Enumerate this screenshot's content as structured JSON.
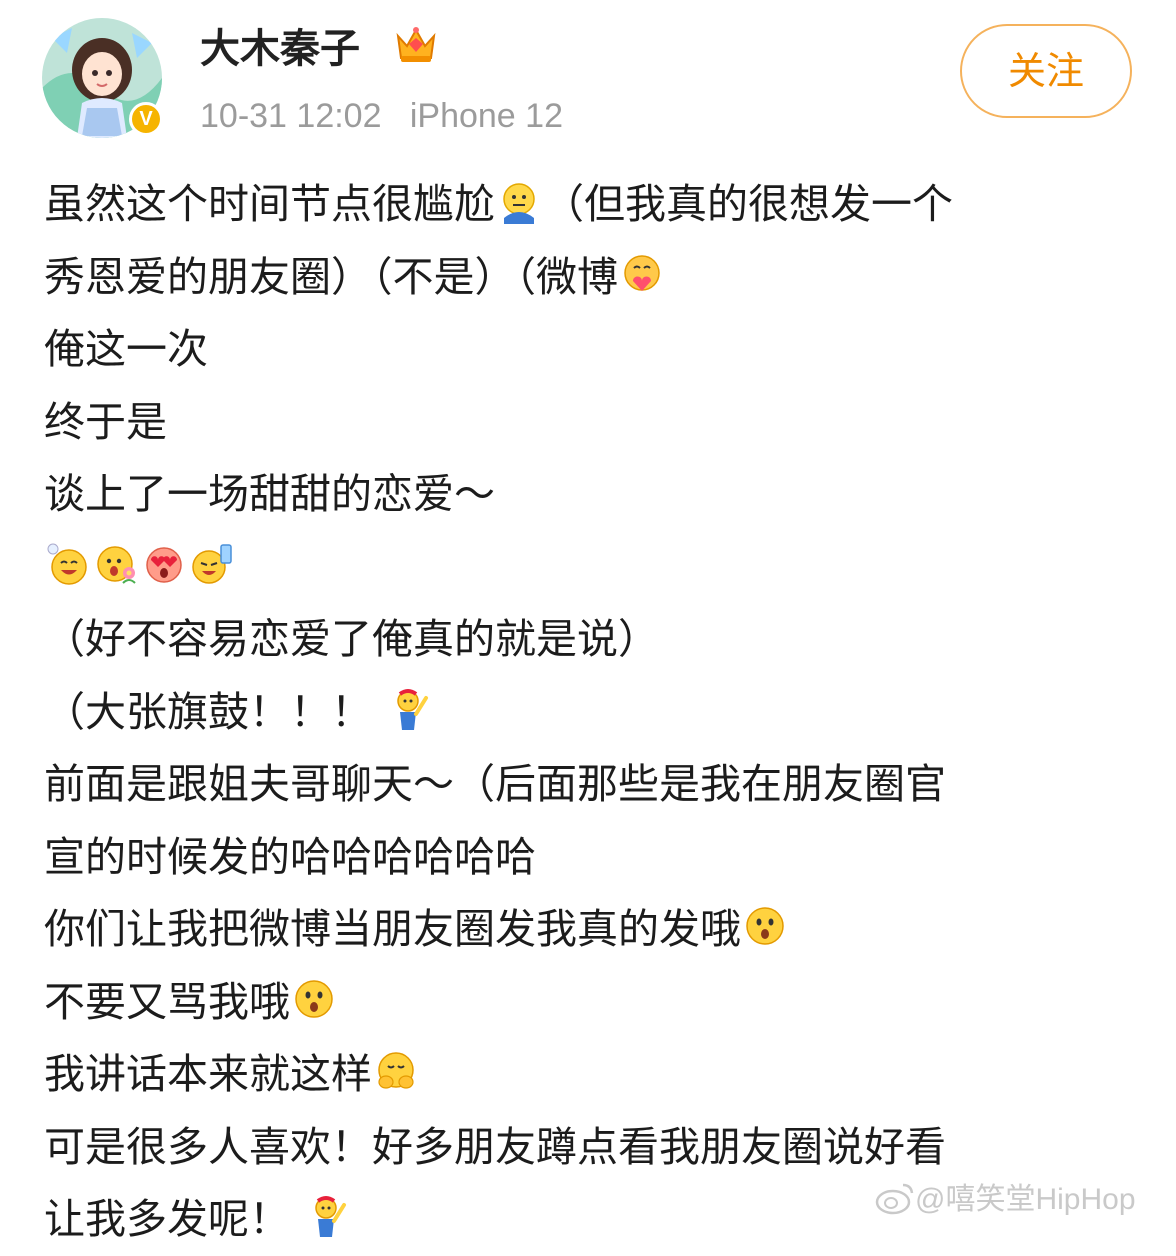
{
  "header": {
    "username": "大木秦子",
    "verified_badge": "V",
    "timestamp": "10-31 12:02",
    "device": "iPhone 12",
    "follow_label": "关注"
  },
  "post": {
    "lines": [
      "虽然这个时间节点很尴尬",
      "（但我真的很想发一个",
      "秀恩爱的朋友圈）（不是）（微博",
      "俺这一次",
      "终于是",
      "谈上了一场甜甜的恋爱～",
      "（好不容易恋爱了俺真的就是说）",
      "（大张旗鼓！！！",
      "前面是跟姐夫哥聊天～（后面那些是我在朋友圈官",
      "宣的时候发的哈哈哈哈哈哈",
      "你们让我把微博当朋友圈发我真的发哦",
      "不要又骂我哦",
      "我讲话本来就这样",
      "可是很多人喜欢！好多朋友蹲点看我朋友圈说好看",
      "让我多发呢！"
    ],
    "emojis": {
      "awkward": "awkward-face-icon",
      "hug": "hugging-heart-face-icon",
      "row": [
        "grin-sweat-face-icon",
        "flower-face-icon",
        "heart-eyes-face-icon",
        "cheers-face-icon"
      ],
      "cheer": "cheering-figure-icon",
      "surprised": "surprised-face-icon",
      "shy": "shy-covering-face-icon"
    }
  },
  "watermark": {
    "text": "@嘻笑堂HipHop",
    "icon": "weibo-logo-icon"
  },
  "colors": {
    "follow_text": "#f08a00",
    "follow_border": "#f5b25c",
    "meta_text": "#9b9b9b",
    "badge": "#f6b400"
  }
}
